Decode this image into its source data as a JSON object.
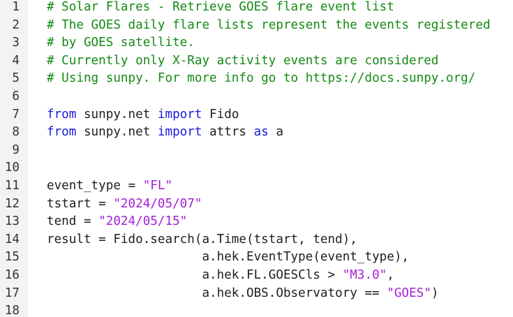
{
  "colors": {
    "comment": "#148a14",
    "keyword": "#1a1ad9",
    "string": "#a31fd6",
    "plain": "#1e1e1e",
    "gutter_bg": "#f3f3f3",
    "background": "#ffffff"
  },
  "lines": [
    {
      "number": "1",
      "tokens": [
        {
          "type": "comment",
          "text": "# Solar Flares - Retrieve GOES flare event list"
        }
      ]
    },
    {
      "number": "2",
      "tokens": [
        {
          "type": "comment",
          "text": "# The GOES daily flare lists represent the events registered"
        }
      ]
    },
    {
      "number": "3",
      "tokens": [
        {
          "type": "comment",
          "text": "# by GOES satellite."
        }
      ]
    },
    {
      "number": "4",
      "tokens": [
        {
          "type": "comment",
          "text": "# Currently only X-Ray activity events are considered"
        }
      ]
    },
    {
      "number": "5",
      "tokens": [
        {
          "type": "comment",
          "text": "# Using sunpy. For more info go to https://docs.sunpy.org/"
        }
      ]
    },
    {
      "number": "6",
      "tokens": []
    },
    {
      "number": "7",
      "tokens": [
        {
          "type": "keyword",
          "text": "from"
        },
        {
          "type": "plain",
          "text": " sunpy.net "
        },
        {
          "type": "keyword",
          "text": "import"
        },
        {
          "type": "plain",
          "text": " Fido"
        }
      ]
    },
    {
      "number": "8",
      "tokens": [
        {
          "type": "keyword",
          "text": "from"
        },
        {
          "type": "plain",
          "text": " sunpy.net "
        },
        {
          "type": "keyword",
          "text": "import"
        },
        {
          "type": "plain",
          "text": " attrs "
        },
        {
          "type": "keyword",
          "text": "as"
        },
        {
          "type": "plain",
          "text": " a"
        }
      ]
    },
    {
      "number": "9",
      "tokens": []
    },
    {
      "number": "10",
      "tokens": []
    },
    {
      "number": "11",
      "tokens": [
        {
          "type": "plain",
          "text": "event_type = "
        },
        {
          "type": "string",
          "text": "\"FL\""
        }
      ]
    },
    {
      "number": "12",
      "tokens": [
        {
          "type": "plain",
          "text": "tstart = "
        },
        {
          "type": "string",
          "text": "\"2024/05/07\""
        }
      ]
    },
    {
      "number": "13",
      "tokens": [
        {
          "type": "plain",
          "text": "tend = "
        },
        {
          "type": "string",
          "text": "\"2024/05/15\""
        }
      ]
    },
    {
      "number": "14",
      "tokens": [
        {
          "type": "plain",
          "text": "result = Fido.search(a.Time(tstart, tend),"
        }
      ]
    },
    {
      "number": "15",
      "tokens": [
        {
          "type": "plain",
          "text": "                     a.hek.EventType(event_type),"
        }
      ]
    },
    {
      "number": "16",
      "tokens": [
        {
          "type": "plain",
          "text": "                     a.hek.FL.GOESCls > "
        },
        {
          "type": "string",
          "text": "\"M3.0\""
        },
        {
          "type": "plain",
          "text": ","
        }
      ]
    },
    {
      "number": "17",
      "tokens": [
        {
          "type": "plain",
          "text": "                     a.hek.OBS.Observatory == "
        },
        {
          "type": "string",
          "text": "\"GOES\""
        },
        {
          "type": "plain",
          "text": ")"
        }
      ]
    },
    {
      "number": "18",
      "tokens": []
    }
  ]
}
